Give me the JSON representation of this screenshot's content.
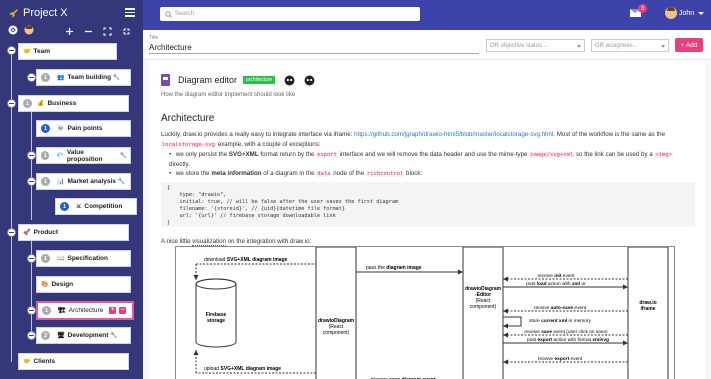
{
  "app": {
    "title": "Project X"
  },
  "sidebar": {
    "nodes": [
      {
        "label": "Team",
        "emoji": "🤝",
        "badge": ""
      },
      {
        "label": "Team building",
        "emoji": "👥",
        "badge": "1",
        "suffix": "🔧"
      },
      {
        "label": "Business",
        "emoji": "💰",
        "badge": ""
      },
      {
        "label": "Pain points",
        "emoji": "💀",
        "badge": "1"
      },
      {
        "label": "Value proposition",
        "emoji": "💎",
        "badge": "1",
        "suffix": "🔧"
      },
      {
        "label": "Market analysis",
        "emoji": "📊",
        "badge": "1",
        "suffix": "🔧"
      },
      {
        "label": "Competition",
        "emoji": "⚔",
        "badge": "1"
      },
      {
        "label": "Product",
        "emoji": "🚀",
        "badge": ""
      },
      {
        "label": "Specification",
        "emoji": "📖",
        "badge": "1"
      },
      {
        "label": "Design",
        "emoji": "🎨",
        "badge": ""
      },
      {
        "label": "Architecture",
        "emoji": "🏗",
        "badge": "1"
      },
      {
        "label": "Development",
        "emoji": "🖥",
        "badge": "2",
        "suffix": "🔧"
      },
      {
        "label": "Clients",
        "emoji": "🤝",
        "badge": ""
      }
    ],
    "selected_add": "+",
    "selected_remove": "−"
  },
  "topbar": {
    "search_placeholder": "Search",
    "notifications": "3",
    "user": "John"
  },
  "titlebar": {
    "label": "Title",
    "value": "Architecture",
    "status_placeholder": "OR objective status...",
    "assignees_placeholder": "OR assignees...",
    "add_label": "+ Add"
  },
  "doc": {
    "title": "Diagram editor",
    "tag": "architecture",
    "subtitle": "How the diagram editor implement should look like",
    "h2": "Architecture",
    "p1_a": "Luckily, draw.io provides a really easy to integrate interface via iframe: ",
    "p1_link": "https://github.com/jgraph/drawio-html5/blob/master/localstorage-svg.html",
    "p1_b": ". Most of the workflow is the same as the ",
    "p1_code": "localstorage-svg",
    "p1_c": " example, with a couple of exceptions:",
    "li1_a": "we only persist the ",
    "li1_b": "SVG+XML",
    "li1_c": " format return by the ",
    "li1_code1": "export",
    "li1_d": " interface and we will remove the data header and use the mime-type ",
    "li1_code2": "image/svg+xml",
    "li1_e": " so the link can be used by a ",
    "li1_code3": "<img>",
    "li1_f": " directly.",
    "li2_a": "we store the ",
    "li2_b": "meta information",
    "li2_c": " of a diagram in the ",
    "li2_code1": "data",
    "li2_d": " node of the ",
    "li2_code2": "richcontrol",
    "li2_e": " block:",
    "code": "{\n    type: \"drawio\",\n    initial: true, // will be false after the user saves the first diagram\n    filename: '{storeid}', // {uid}{datetime file format}\n    url: '{url}' // firebase storage downloadable link\n}",
    "p2_a": "A nice little ",
    "p2_b": "visualization",
    "p2_c": " on the integration with draw.io:"
  },
  "diagram": {
    "download_a": "download ",
    "download_b": "SVG+XML diagram image",
    "upload_a": "upload ",
    "upload_b": "SVG+XML diagram image",
    "firebase": "Firebase storage",
    "drawio_diagram": "drawioDiagram (React component)",
    "drawio_editor": "drawioDiagram -Editor (React component)",
    "drawio_iframe": "draw.io iframe",
    "pass_a": "pass the ",
    "pass_b": "diagram image",
    "triggers_a": "triggers ",
    "triggers_b": "save diagram event",
    "msgs": [
      [
        "receive ",
        "init",
        " event"
      ],
      [
        "post ",
        "load",
        " action with ",
        "xml",
        " or"
      ],
      [
        "receive ",
        "auto-save",
        " event"
      ],
      [
        "store ",
        "current xml",
        " in memory"
      ],
      [
        "receive ",
        "save",
        " event (user click on save)"
      ],
      [
        "post ",
        "export",
        " action with format ",
        "xmlsvg",
        ""
      ],
      [
        "receive ",
        "export",
        " event"
      ]
    ]
  }
}
